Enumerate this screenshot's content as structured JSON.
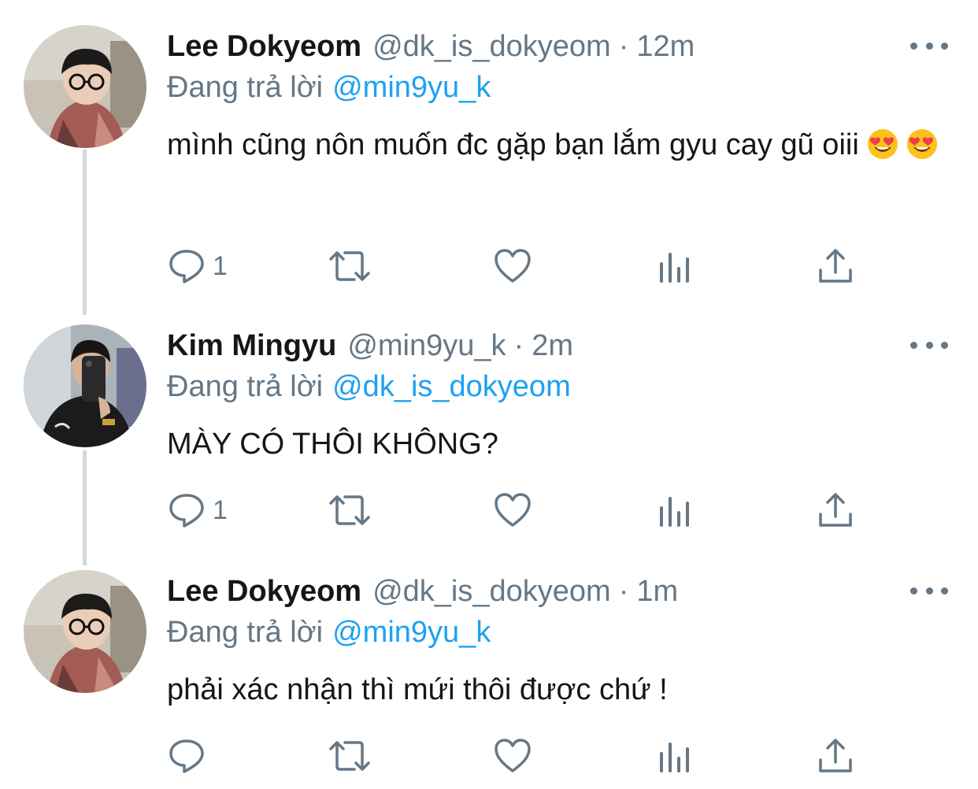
{
  "colors": {
    "text": "#14171a",
    "secondary": "#657786",
    "link": "#1da1f2",
    "thread_line": "#cfd9de"
  },
  "tweets": [
    {
      "author_name": "Lee Dokyeom",
      "author_handle": "@dk_is_dokyeom",
      "separator": "·",
      "time": "12m",
      "replying_label": "Đang trả lời",
      "replying_to": "@min9yu_k",
      "text": "mình cũng nôn muốn đc gặp bạn lắm gyu cay gũ oiii",
      "emojis": [
        "heart-eyes-emoji",
        "heart-eyes-emoji"
      ],
      "reply_count": "1"
    },
    {
      "author_name": "Kim Mingyu",
      "author_handle": "@min9yu_k",
      "separator": "·",
      "time": "2m",
      "replying_label": "Đang trả lời",
      "replying_to": "@dk_is_dokyeom",
      "text": "MÀY CÓ THÔI KHÔNG?",
      "reply_count": "1"
    },
    {
      "author_name": "Lee Dokyeom",
      "author_handle": "@dk_is_dokyeom",
      "separator": "·",
      "time": "1m",
      "replying_label": "Đang trả lời",
      "replying_to": "@min9yu_k",
      "text": "phải xác nhận thì mứi thôi được chứ !",
      "reply_count": ""
    }
  ],
  "icons": {
    "reply": "reply-icon",
    "retweet": "retweet-icon",
    "like": "heart-icon",
    "analytics": "analytics-icon",
    "share": "share-icon",
    "more": "more-options-icon"
  }
}
